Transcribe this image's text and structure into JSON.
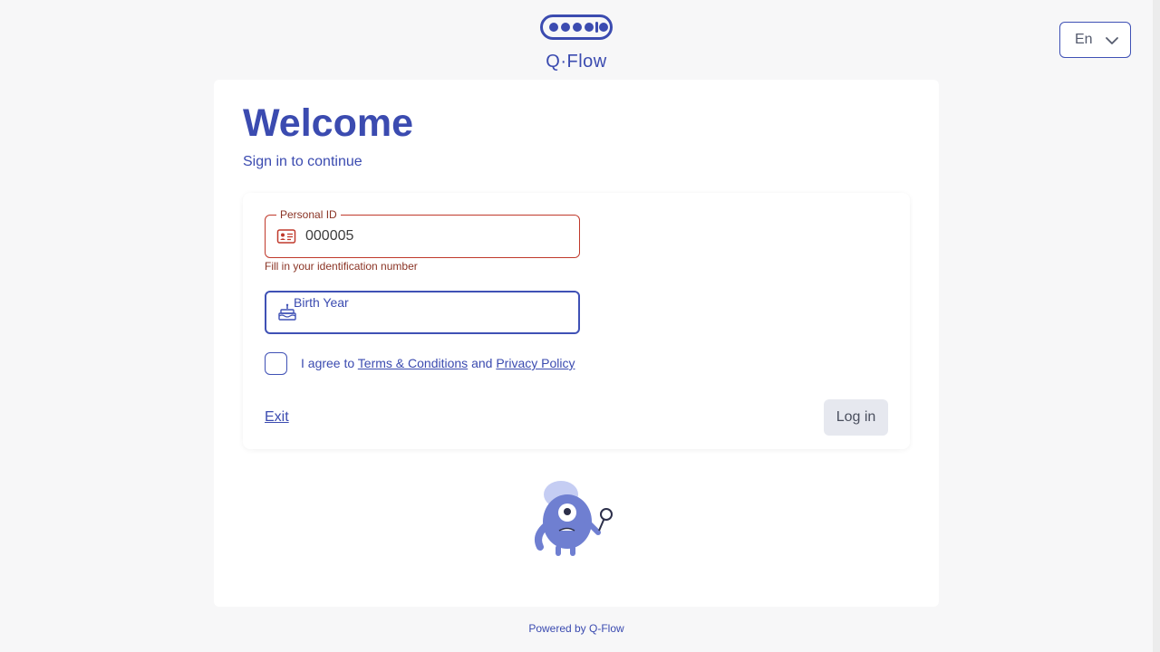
{
  "app": {
    "logo_text": "Q·Flow",
    "powered_by": "Powered by Q-Flow"
  },
  "language": {
    "selected": "En",
    "icon": "chevron-down-icon"
  },
  "header": {
    "title": "Welcome",
    "subtitle": "Sign in to continue"
  },
  "form": {
    "personal_id": {
      "label": "Personal ID",
      "value": "000005",
      "icon": "id-card-icon",
      "error": "Fill in your identification number"
    },
    "birth_year": {
      "label": "Birth Year",
      "value": "",
      "icon": "birthday-cake-icon"
    },
    "agreement": {
      "prefix": "I agree to",
      "terms_link": "Terms & Conditions",
      "conjunction": "and",
      "privacy_link": "Privacy Policy",
      "checked": false
    },
    "exit_label": "Exit",
    "login_label": "Log in"
  },
  "colors": {
    "primary": "#3f51b5",
    "error": "#c0392b",
    "background": "#f7f7f8",
    "button_disabled": "#e6e8ef",
    "mascot": "#6f7fd1",
    "mascot_light": "#c5cdf3"
  }
}
